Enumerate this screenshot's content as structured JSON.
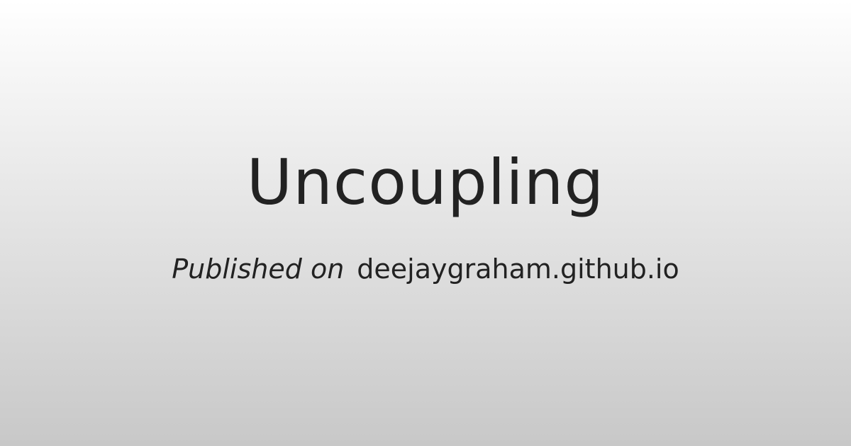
{
  "title": "Uncoupling",
  "subtitle": {
    "prefix": "Published on",
    "site": "deejaygraham.github.io"
  },
  "colors": {
    "text": "#222222",
    "background_top": "#ffffff",
    "background_bottom": "#c8c8c8"
  }
}
